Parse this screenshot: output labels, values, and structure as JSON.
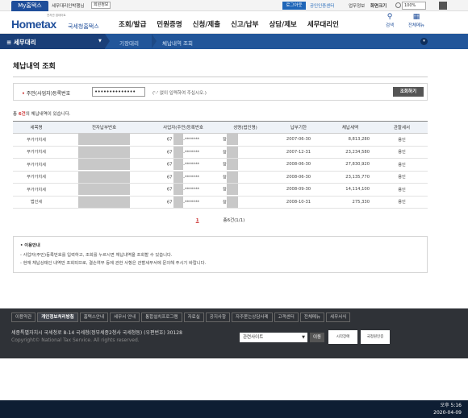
{
  "topbar": {
    "my_tab": "My홈택스",
    "user": "세무대리인박행님",
    "member_info": "회원정보",
    "logout": "로그아웃",
    "cert_center": "공인인증센터",
    "inquiry": "업무정보",
    "zoom_label": "화면크기",
    "zoom_value": "100%"
  },
  "header": {
    "logo": "Hometax",
    "logo_sub": "국세청홈택스",
    "logo_tiny": "전자관 업데이트",
    "menu": [
      "조회/발급",
      "민원증명",
      "신청/제출",
      "신고/납부",
      "상담/제보",
      "세무대리인"
    ],
    "search_label": "검색",
    "allmenu_label": "전체메뉴"
  },
  "subnav": {
    "title": "세무대리",
    "crumb1": "기장대리",
    "crumb2": "체납내역 조회"
  },
  "page": {
    "title": "체납내역 조회",
    "field_label": "주민(사업자)등록번호",
    "field_value": "••••••••••••••",
    "hint": "('-' 없이 입력하여 주십시오.)",
    "search_button": "조회하기",
    "count_prefix": "총 ",
    "count_num": "6건",
    "count_suffix": "의 체납내역이 있습니다."
  },
  "table": {
    "headers": [
      "세목명",
      "전자납부번호",
      "사업자(주민)등록번호",
      "성명(법인명)",
      "납부기한",
      "체납세액",
      "관할세서"
    ],
    "rows": [
      {
        "tax": "부가가치세",
        "id": "67",
        "mask": "-*******",
        "name": "장",
        "due": "2007-06-30",
        "amount": "8,813,280",
        "office": "용인"
      },
      {
        "tax": "부가가치세",
        "id": "67",
        "mask": "-*******",
        "name": "장",
        "due": "2007-12-31",
        "amount": "23,234,580",
        "office": "용인"
      },
      {
        "tax": "부가가치세",
        "id": "67",
        "mask": "-*******",
        "name": "장",
        "due": "2008-06-30",
        "amount": "27,830,920",
        "office": "용인"
      },
      {
        "tax": "부가가치세",
        "id": "67",
        "mask": "-*******",
        "name": "장",
        "due": "2008-06-30",
        "amount": "23,135,770",
        "office": "용인"
      },
      {
        "tax": "부가가치세",
        "id": "67",
        "mask": "-*******",
        "name": "장",
        "due": "2008-09-30",
        "amount": "14,114,100",
        "office": "용인"
      },
      {
        "tax": "법인세",
        "id": "67",
        "mask": "-*******",
        "name": "장",
        "due": "2008-10-31",
        "amount": "275,330",
        "office": "용인"
      }
    ]
  },
  "pager": {
    "current": "1",
    "total": "총6건(1/1)"
  },
  "notice": {
    "title": "이용안내",
    "line1": "- 사업자(주민)등록번호를 입력하고, 조회를 누르시면 체납내역을 조회할 수 있습니다.",
    "line2": "- 현재 체납상태인 내역만 조회되므로, 결손여부 등에 관한 사항은 관할세무서에 문의해 주시기 바랍니다."
  },
  "footer": {
    "menu": [
      "이용약관",
      "개인정보처리방침",
      "홈택스안내",
      "세무서 안내",
      "통합설치프로그램",
      "자료실",
      "공지사항",
      "자주묻는상담사례",
      "고객센터",
      "전체메뉴",
      "세무서식"
    ],
    "address": "세종특별자치시 국세청로 8-14 국세청(정부세종2청사 국세청동) (우편번호) 30128",
    "copyright": "Copyright© National Tax Service. All rights reserved.",
    "related_sites": "관련사이트",
    "go": "이동",
    "badge1": "시각장애",
    "badge2": "국정원인증"
  },
  "taskbar": {
    "time": "오후 5:16",
    "date": "2020-04-09"
  }
}
